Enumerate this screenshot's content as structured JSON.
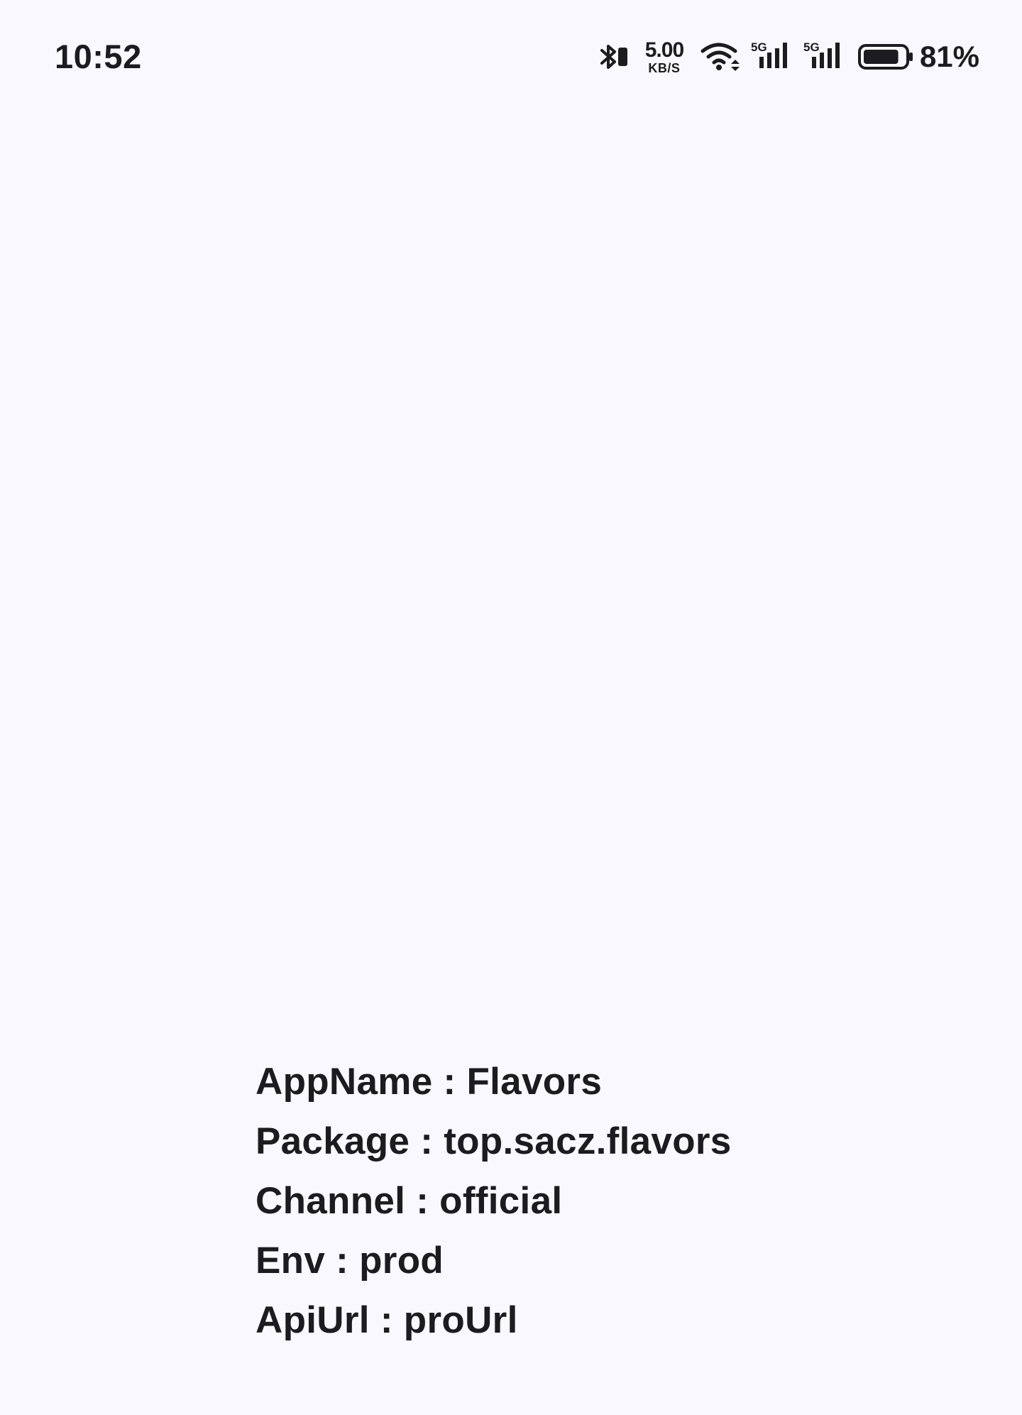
{
  "status_bar": {
    "time": "10:52",
    "net_speed_value": "5.00",
    "net_speed_unit": "KB/S",
    "battery_percent": "81%",
    "battery_level": 0.81,
    "signal_1_label": "5G",
    "signal_2_label": "5G",
    "icons": [
      "bluetooth-icon",
      "wifi-icon",
      "signal-icon",
      "signal-icon",
      "battery-icon"
    ]
  },
  "info": {
    "app_name": "AppName : Flavors",
    "package": "Package : top.sacz.flavors",
    "channel": "Channel : official",
    "env": "Env : prod",
    "api_url": "ApiUrl : proUrl"
  },
  "colors": {
    "background": "#f9f8fe",
    "text": "#1c1b20"
  }
}
